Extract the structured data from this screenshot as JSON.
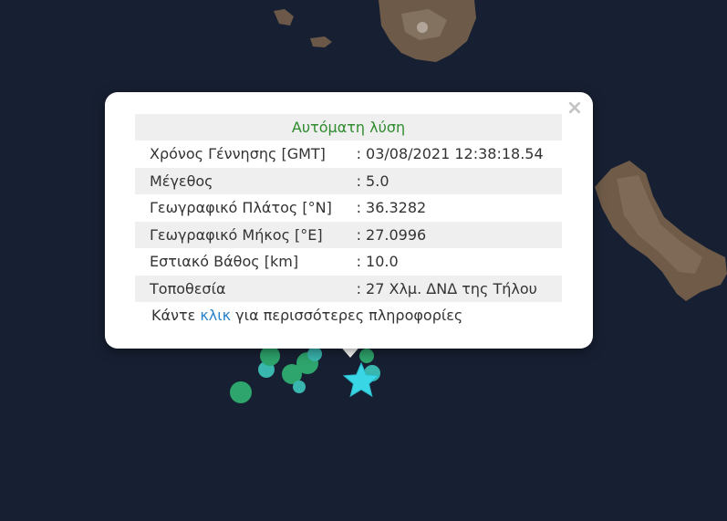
{
  "popup": {
    "close_label": "×",
    "title": "Αυτόματη λύση",
    "rows": [
      {
        "label": "Χρόνος Γέννησης [GMT]",
        "value": ": 03/08/2021 12:38:18.54"
      },
      {
        "label": "Μέγεθος",
        "value": ": 5.0"
      },
      {
        "label": "Γεωγραφικό Πλάτος [°N]",
        "value": ": 36.3282"
      },
      {
        "label": "Γεωγραφικό Μήκος [°E]",
        "value": ": 27.0996"
      },
      {
        "label": "Εστιακό Βάθος [km]",
        "value": ": 10.0"
      },
      {
        "label": "Τοποθεσία",
        "value": ": 27 Χλμ. ΔΝΔ της Τήλου"
      }
    ],
    "more_prefix": "Κάντε ",
    "more_link": "κλικ",
    "more_suffix": " για περισσότερες πληροφορίες"
  },
  "colors": {
    "sea": "#172033",
    "land": "#6e5a49",
    "event_green": "#2ea56c",
    "event_teal": "#39b6ae",
    "star": "#39d6e6",
    "title_green": "#2e8b2e",
    "link_blue": "#2a83c9"
  },
  "markers": {
    "main_event_icon": "star-icon",
    "other_events_icon": "circle-icon"
  }
}
